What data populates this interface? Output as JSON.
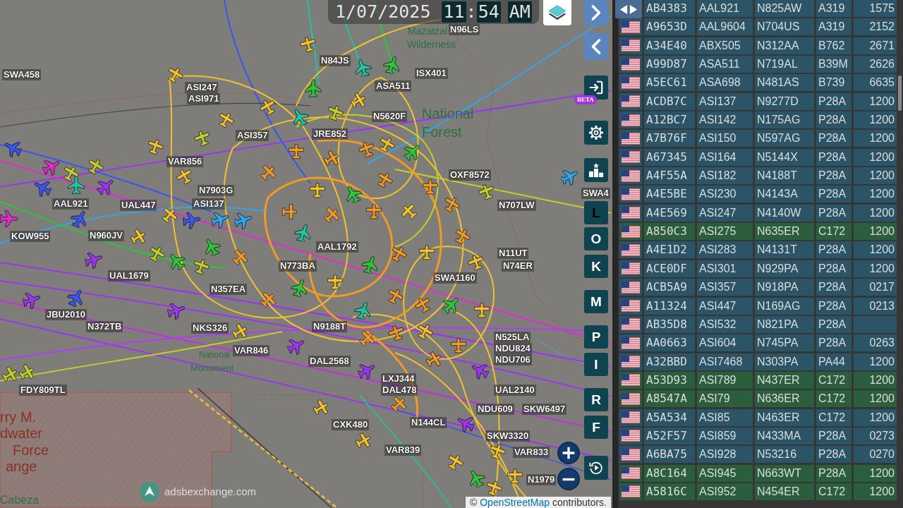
{
  "clock": {
    "date": "1/07/2025",
    "hours": "11",
    "separator": ":",
    "minutes": "54",
    "period": "AM"
  },
  "map": {
    "places": [
      {
        "kind": "park",
        "text": "Mazatzal"
      },
      {
        "kind": "park",
        "text": "Wilderness"
      },
      {
        "kind": "park",
        "text": "National"
      },
      {
        "kind": "park",
        "text": "Forest"
      },
      {
        "kind": "park",
        "text": "National"
      },
      {
        "kind": "park",
        "text": "Monument"
      },
      {
        "kind": "military",
        "text": "rry M."
      },
      {
        "kind": "military",
        "text": "dwater"
      },
      {
        "kind": "military",
        "text": "Force"
      },
      {
        "kind": "military",
        "text": "ange"
      },
      {
        "kind": "park",
        "text": "Cabeza"
      }
    ],
    "aircraft": [
      {
        "kind": "prop",
        "color": "#f2c12e"
      },
      {
        "kind": "jet",
        "color": "#22c4a0"
      },
      {
        "kind": "jet",
        "color": "#2ec53a"
      },
      {
        "kind": "prop",
        "color": "#f2c12e"
      },
      {
        "kind": "jet",
        "color": "#2ec53a"
      },
      {
        "kind": "prop",
        "color": "#f2c12e"
      },
      {
        "kind": "jet",
        "color": "#22c4a0"
      },
      {
        "kind": "prop",
        "color": "#f2c12e"
      },
      {
        "kind": "prop",
        "color": "#c6cf2a"
      },
      {
        "kind": "prop",
        "color": "#f2c12e"
      },
      {
        "kind": "prop",
        "color": "#f2c12e"
      },
      {
        "kind": "prop",
        "color": "#f2c12e"
      },
      {
        "kind": "prop",
        "color": "#f2c12e"
      },
      {
        "kind": "jet",
        "color": "#3b55f0"
      },
      {
        "kind": "jet",
        "color": "#e02ccf"
      },
      {
        "kind": "prop",
        "color": "#c6cf2a"
      },
      {
        "kind": "prop",
        "color": "#c6cf2a"
      },
      {
        "kind": "jet",
        "color": "#3b55f0"
      },
      {
        "kind": "jet",
        "color": "#9b35f2"
      },
      {
        "kind": "jet",
        "color": "#22c4a0"
      },
      {
        "kind": "jet",
        "color": "#3b55f0"
      },
      {
        "kind": "jet",
        "color": "#e02ccf"
      },
      {
        "kind": "jet",
        "color": "#9b35f2"
      },
      {
        "kind": "jet",
        "color": "#9b35f2"
      },
      {
        "kind": "jet",
        "color": "#3b55f0"
      },
      {
        "kind": "jet",
        "color": "#9b35f2"
      },
      {
        "kind": "prop",
        "color": "#f2c12e"
      },
      {
        "kind": "jet",
        "color": "#9b35f2"
      },
      {
        "kind": "prop",
        "color": "#c6cf2a"
      },
      {
        "kind": "prop",
        "color": "#c6cf2a"
      },
      {
        "kind": "jet",
        "color": "#9b35f2"
      },
      {
        "kind": "jet",
        "color": "#9b35f2"
      },
      {
        "kind": "prop",
        "color": "#f39a26"
      },
      {
        "kind": "jet",
        "color": "#9b35f2"
      },
      {
        "kind": "prop",
        "color": "#f2c12e"
      },
      {
        "kind": "prop",
        "color": "#f2c12e"
      },
      {
        "kind": "prop",
        "color": "#f2c12e"
      },
      {
        "kind": "jet",
        "color": "#2ec53a"
      },
      {
        "kind": "prop",
        "color": "#f2c12e"
      },
      {
        "kind": "prop",
        "color": "#f2c12e"
      },
      {
        "kind": "prop",
        "color": "#f2c12e"
      },
      {
        "kind": "jet",
        "color": "#2fa6f2"
      },
      {
        "kind": "prop",
        "color": "#f39a26"
      },
      {
        "kind": "prop",
        "color": "#f39a26"
      },
      {
        "kind": "prop",
        "color": "#f39a26"
      },
      {
        "kind": "prop",
        "color": "#f2c12e"
      },
      {
        "kind": "jet",
        "color": "#2ec53a"
      },
      {
        "kind": "prop",
        "color": "#f39a26"
      },
      {
        "kind": "prop",
        "color": "#f39a26"
      },
      {
        "kind": "jet",
        "color": "#2ec53a"
      },
      {
        "kind": "prop",
        "color": "#f2c12e"
      },
      {
        "kind": "prop",
        "color": "#f39a26"
      },
      {
        "kind": "prop",
        "color": "#f39a26"
      },
      {
        "kind": "prop",
        "color": "#f39a26"
      },
      {
        "kind": "prop",
        "color": "#f39a26"
      },
      {
        "kind": "prop",
        "color": "#f2c12e"
      },
      {
        "kind": "prop",
        "color": "#f39a26"
      },
      {
        "kind": "prop",
        "color": "#c6cf2a"
      },
      {
        "kind": "jet",
        "color": "#3b55f0"
      },
      {
        "kind": "jet",
        "color": "#2fa6f2"
      },
      {
        "kind": "jet",
        "color": "#2fa6f2"
      },
      {
        "kind": "jet",
        "color": "#22c4a0"
      },
      {
        "kind": "jet",
        "color": "#2ec53a"
      },
      {
        "kind": "jet",
        "color": "#2ec53a"
      },
      {
        "kind": "prop",
        "color": "#c6cf2a"
      },
      {
        "kind": "prop",
        "color": "#c6cf2a"
      },
      {
        "kind": "prop",
        "color": "#f39a26"
      },
      {
        "kind": "jet",
        "color": "#2ec53a"
      },
      {
        "kind": "prop",
        "color": "#f39a26"
      },
      {
        "kind": "prop",
        "color": "#f2c12e"
      },
      {
        "kind": "jet",
        "color": "#2ec53a"
      },
      {
        "kind": "prop",
        "color": "#f39a26"
      },
      {
        "kind": "prop",
        "color": "#f2c12e"
      },
      {
        "kind": "prop",
        "color": "#f39a26"
      },
      {
        "kind": "prop",
        "color": "#f2c12e"
      },
      {
        "kind": "jet",
        "color": "#22c4a0"
      },
      {
        "kind": "prop",
        "color": "#f39a26"
      },
      {
        "kind": "prop",
        "color": "#f39a26"
      },
      {
        "kind": "jet",
        "color": "#2ec53a"
      },
      {
        "kind": "prop",
        "color": "#f2c12e"
      },
      {
        "kind": "prop",
        "color": "#f39a26"
      },
      {
        "kind": "prop",
        "color": "#f39a26"
      },
      {
        "kind": "prop",
        "color": "#f2c12e"
      },
      {
        "kind": "prop",
        "color": "#f39a26"
      },
      {
        "kind": "prop",
        "color": "#f39a26"
      },
      {
        "kind": "prop",
        "color": "#f2c12e"
      },
      {
        "kind": "prop",
        "color": "#c6cf2a"
      }
    ],
    "labels": [
      "N96LS",
      "N84JS",
      "SWA458",
      "ISX401",
      "ASI247",
      "ASA511",
      "ASI971",
      "N5620F",
      "ASI357",
      "JRE852",
      "VAR856",
      "OXF8572",
      "N7903G",
      "SWA4",
      "AAL921",
      "UAL447",
      "ASI137",
      "N707LW",
      "KOW955",
      "N960JV",
      "AAL1792",
      "N11UT",
      "N773BA",
      "N74ER",
      "UAL1679",
      "SWA1160",
      "N357EA",
      "JBU2010",
      "N372TB",
      "NKS326",
      "N9188T",
      "N525LA",
      "VAR846",
      "NDU824",
      "DAL2568",
      "NDU706",
      "LXJ344",
      "FDY809TL",
      "DAL478",
      "UAL2140",
      "NDU609",
      "SKW6497",
      "CXK480",
      "N144CL",
      "SKW3320",
      "VAR839",
      "VAR833",
      "N1979"
    ]
  },
  "controls": {
    "beta_badge": "BETA",
    "keys": [
      {
        "label": "L",
        "active": true
      },
      {
        "label": "O",
        "active": false
      },
      {
        "label": "K",
        "active": false
      },
      {
        "label": "M",
        "active": false
      },
      {
        "label": "P",
        "active": false
      },
      {
        "label": "I",
        "active": false
      },
      {
        "label": "R",
        "active": false
      },
      {
        "label": "F",
        "active": false
      }
    ]
  },
  "logo": {
    "text": "adsbexchange.com"
  },
  "attribution": {
    "symbol": "©",
    "link": "OpenStreetMap",
    "text": "contributors."
  },
  "table": {
    "rows": [
      {
        "column_2": "AB4383",
        "column_3": "AAL921",
        "column_4": "N825AW",
        "column_5": "A319",
        "column_6": "1575",
        "highlighted": false
      },
      {
        "column_2": "A9653D",
        "column_3": "AAL9604",
        "column_4": "N704US",
        "column_5": "A319",
        "column_6": "2152",
        "highlighted": false
      },
      {
        "column_2": "A34E40",
        "column_3": "ABX505",
        "column_4": "N312AA",
        "column_5": "B762",
        "column_6": "2671",
        "highlighted": false
      },
      {
        "column_2": "A99D87",
        "column_3": "ASA511",
        "column_4": "N719AL",
        "column_5": "B39M",
        "column_6": "2626",
        "highlighted": false
      },
      {
        "column_2": "A5EC61",
        "column_3": "ASA698",
        "column_4": "N481AS",
        "column_5": "B739",
        "column_6": "6635",
        "highlighted": false
      },
      {
        "column_2": "ACDB7C",
        "column_3": "ASI137",
        "column_4": "N9277D",
        "column_5": "P28A",
        "column_6": "1200",
        "highlighted": false
      },
      {
        "column_2": "A12BC7",
        "column_3": "ASI142",
        "column_4": "N175AG",
        "column_5": "P28A",
        "column_6": "1200",
        "highlighted": false
      },
      {
        "column_2": "A7B76F",
        "column_3": "ASI150",
        "column_4": "N597AG",
        "column_5": "P28A",
        "column_6": "1200",
        "highlighted": false
      },
      {
        "column_2": "A67345",
        "column_3": "ASI164",
        "column_4": "N5144X",
        "column_5": "P28A",
        "column_6": "1200",
        "highlighted": false
      },
      {
        "column_2": "A4F55A",
        "column_3": "ASI182",
        "column_4": "N4188T",
        "column_5": "P28A",
        "column_6": "1200",
        "highlighted": false
      },
      {
        "column_2": "A4E5BE",
        "column_3": "ASI230",
        "column_4": "N4143A",
        "column_5": "P28A",
        "column_6": "1200",
        "highlighted": false
      },
      {
        "column_2": "A4E569",
        "column_3": "ASI247",
        "column_4": "N4140W",
        "column_5": "P28A",
        "column_6": "1200",
        "highlighted": false
      },
      {
        "column_2": "A850C3",
        "column_3": "ASI275",
        "column_4": "N635ER",
        "column_5": "C172",
        "column_6": "1200",
        "highlighted": true
      },
      {
        "column_2": "A4E1D2",
        "column_3": "ASI283",
        "column_4": "N4131T",
        "column_5": "P28A",
        "column_6": "1200",
        "highlighted": false
      },
      {
        "column_2": "ACE0DF",
        "column_3": "ASI301",
        "column_4": "N929PA",
        "column_5": "P28A",
        "column_6": "1200",
        "highlighted": false
      },
      {
        "column_2": "ACB5A9",
        "column_3": "ASI357",
        "column_4": "N918PA",
        "column_5": "P28A",
        "column_6": "0217",
        "highlighted": false
      },
      {
        "column_2": "A11324",
        "column_3": "ASI447",
        "column_4": "N169AG",
        "column_5": "P28A",
        "column_6": "0213",
        "highlighted": false
      },
      {
        "column_2": "AB35D8",
        "column_3": "ASI532",
        "column_4": "N821PA",
        "column_5": "P28A",
        "highlighted": false
      },
      {
        "column_2": "AA0663",
        "column_3": "ASI604",
        "column_4": "N745PA",
        "column_5": "P28A",
        "column_6": "0263",
        "highlighted": false
      },
      {
        "column_2": "A32BBD",
        "column_3": "ASI7468",
        "column_4": "N303PA",
        "column_5": "PA44",
        "column_6": "1200",
        "highlighted": false
      },
      {
        "column_2": "A53D93",
        "column_3": "ASI789",
        "column_4": "N437ER",
        "column_5": "C172",
        "column_6": "1200",
        "highlighted": true
      },
      {
        "column_2": "A8547A",
        "column_3": "ASI79",
        "column_4": "N636ER",
        "column_5": "C172",
        "column_6": "1200",
        "highlighted": true
      },
      {
        "column_2": "A5A534",
        "column_3": "ASI85",
        "column_4": "N463ER",
        "column_5": "C172",
        "column_6": "1200",
        "highlighted": false
      },
      {
        "column_2": "A52F57",
        "column_3": "ASI859",
        "column_4": "N433MA",
        "column_5": "P28A",
        "column_6": "0273",
        "highlighted": false
      },
      {
        "column_2": "A6BA75",
        "column_3": "ASI928",
        "column_4": "N53216",
        "column_5": "P28A",
        "column_6": "0270",
        "highlighted": false
      },
      {
        "column_2": "A8C164",
        "column_3": "ASI945",
        "column_4": "N663WT",
        "column_5": "P28A",
        "column_6": "1200",
        "highlighted": true
      },
      {
        "column_2": "A5816C",
        "column_3": "ASI952",
        "column_4": "N454ER",
        "column_5": "C172",
        "column_6": "1200",
        "highlighted": true
      }
    ]
  }
}
